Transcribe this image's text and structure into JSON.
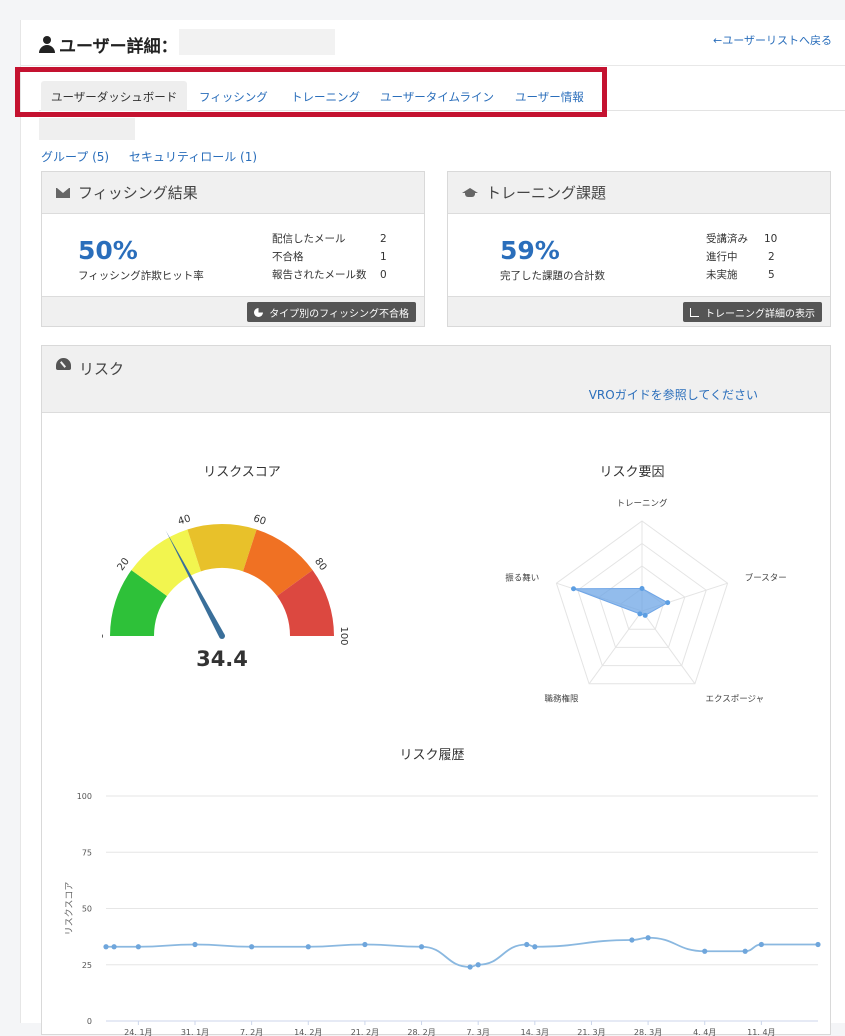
{
  "header": {
    "title": "ユーザー詳細：",
    "back_link": "←ユーザーリストへ戻る"
  },
  "tabs": [
    {
      "label": "ユーザーダッシュボード",
      "active": true
    },
    {
      "label": "フィッシング",
      "active": false
    },
    {
      "label": "トレーニング",
      "active": false
    },
    {
      "label": "ユーザータイムライン",
      "active": false
    },
    {
      "label": "ユーザー情報",
      "active": false
    }
  ],
  "sub_links": {
    "groups": "グループ (5)",
    "security_roles": "セキュリティロール (1)"
  },
  "phishing": {
    "title": "フィッシング結果",
    "percent": "50%",
    "percent_label": "フィッシング詐欺ヒット率",
    "stats": [
      {
        "label": "配信したメール",
        "value": "2"
      },
      {
        "label": "不合格",
        "value": "1"
      },
      {
        "label": "報告されたメール数",
        "value": "0"
      }
    ],
    "button": "タイプ別のフィッシング不合格"
  },
  "training": {
    "title": "トレーニング課題",
    "percent": "59%",
    "percent_label": "完了した課題の合計数",
    "stats": [
      {
        "label": "受講済み",
        "value": "10"
      },
      {
        "label": "進行中",
        "value": "2"
      },
      {
        "label": "未実施",
        "value": "5"
      }
    ],
    "button": "トレーニング詳細の表示"
  },
  "risk": {
    "title": "リスク",
    "vro_link": "VROガイドを参照してください"
  },
  "colors": {
    "link": "#2a6ebb",
    "highlight": "#c41230",
    "gauge_segments": [
      "#2ec139",
      "#f2f54f",
      "#e8c12a",
      "#f07123",
      "#dc4840"
    ],
    "series": "#8ab8e0"
  },
  "chart_data": [
    {
      "type": "gauge",
      "title": "リスクスコア",
      "value": 34.4,
      "value_label": "34.4",
      "min": 0,
      "max": 100,
      "tick_labels": [
        "0",
        "20",
        "40",
        "60",
        "80",
        "100"
      ],
      "bands": [
        {
          "from": 0,
          "to": 20
        },
        {
          "from": 20,
          "to": 40
        },
        {
          "from": 40,
          "to": 60
        },
        {
          "from": 60,
          "to": 80
        },
        {
          "from": 80,
          "to": 100
        }
      ]
    },
    {
      "type": "radar",
      "title": "リスク要因",
      "axes": [
        "トレーニング",
        "ブースター",
        "エクスポージャ",
        "職務権限",
        "振る舞い"
      ],
      "values": [
        0.25,
        0.3,
        0.06,
        0.04,
        0.8
      ],
      "rings": 4
    },
    {
      "type": "line",
      "title": "リスク履歴",
      "ylabel": "リスクスコア",
      "ylim": [
        0,
        100
      ],
      "yticks": [
        0,
        25,
        50,
        75,
        100
      ],
      "x_ticks": [
        "24. 1月",
        "31. 1月",
        "7. 2月",
        "14. 2月",
        "21. 2月",
        "28. 2月",
        "7. 3月",
        "14. 3月",
        "21. 3月",
        "28. 3月",
        "4. 4月",
        "11. 4月"
      ],
      "xlim": [
        "2024-01-20",
        "2024-04-17"
      ],
      "series": [
        {
          "x": [
            "2024-01-20",
            "2024-01-21",
            "2024-01-24",
            "2024-01-31",
            "2024-02-07",
            "2024-02-14",
            "2024-02-21",
            "2024-02-28",
            "2024-03-05",
            "2024-03-06",
            "2024-03-12",
            "2024-03-13",
            "2024-03-25",
            "2024-03-27",
            "2024-04-03",
            "2024-04-08",
            "2024-04-10",
            "2024-04-17"
          ],
          "values": [
            33,
            33,
            33,
            34,
            33,
            33,
            34,
            33,
            24,
            25,
            34,
            33,
            36,
            37,
            31,
            31,
            34,
            34
          ]
        }
      ]
    }
  ]
}
